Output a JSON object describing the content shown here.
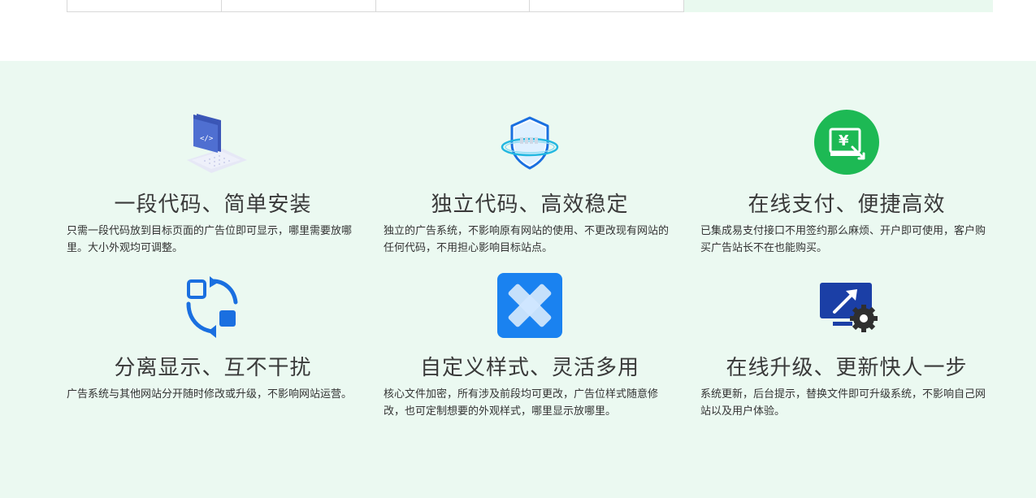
{
  "features": [
    {
      "title": "一段代码、简单安装",
      "desc": "只需一段代码放到目标页面的广告位即可显示，哪里需要放哪里。大小外观均可调整。",
      "icon": "code-window-icon"
    },
    {
      "title": "独立代码、高效稳定",
      "desc": "独立的广告系统，不影响原有网站的使用、不更改现有网站的任何代码，不用担心影响目标站点。",
      "icon": "shield-icon"
    },
    {
      "title": "在线支付、便捷高效",
      "desc": "已集成易支付接口不用签约那么麻烦、开户即可使用，客户购买广告站长不在也能购买。",
      "icon": "yuan-payment-icon"
    },
    {
      "title": "分离显示、互不干扰",
      "desc": "广告系统与其他网站分开随时修改或升级，不影响网站运营。",
      "icon": "sync-arrows-icon"
    },
    {
      "title": "自定义样式、灵活多用",
      "desc": "核心文件加密，所有涉及前段均可更改，广告位样式随意修改，也可定制想要的外观样式，哪里显示放哪里。",
      "icon": "bandage-cross-icon"
    },
    {
      "title": "在线升级、更新快人一步",
      "desc": "系统更新，后台提示，替换文件即可升级系统，不影响自己网站以及用户体验。",
      "icon": "monitor-upgrade-gear-icon"
    }
  ],
  "colors": {
    "section_bg": "#ebf9f1",
    "payment_green": "#1db954",
    "blue": "#1a73e8"
  }
}
